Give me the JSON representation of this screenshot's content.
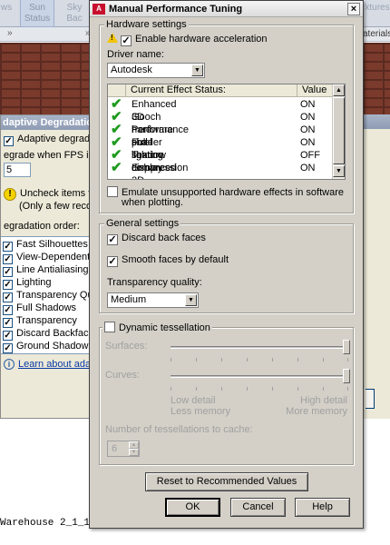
{
  "background": {
    "ribbon": {
      "left_label": "ws",
      "sun_status": "Sun\nStatus",
      "sky_label": "Sky Bac",
      "right_label": "xtures",
      "materials_label": "aterials",
      "collapse_glyph": "»"
    },
    "adaptive_dialog": {
      "title": "daptive Degradation",
      "adaptive_checkbox": "Adaptive degradation",
      "fps_label": "egrade when FPS is belo",
      "fps_value": "5",
      "warning_line1": "Uncheck items that",
      "warning_line2": "(Only a few recomm",
      "order_label": "egradation order:",
      "order_items": [
        "Fast Silhouettes",
        "View-Dependent Ob",
        "Line Antialiasing",
        "Lighting",
        "Transparency Qualit",
        "Full Shadows",
        "Transparency",
        "Discard Backfaces",
        "Ground Shadows"
      ],
      "learn_link": "Learn about adaptive"
    },
    "command_text": "Warehouse 2_1_1"
  },
  "dialog": {
    "title": "Manual Performance Tuning",
    "app_icon_text": "A",
    "close_glyph": "×",
    "hardware": {
      "legend": "Hardware settings",
      "enable_accel": "Enable hardware acceleration",
      "enable_accel_checked": true,
      "driver_label": "Driver name:",
      "driver_value": "Autodesk",
      "status_headers": [
        "Current Effect Status:",
        "Value"
      ],
      "effects": [
        {
          "name": "Enhanced 3D Performance",
          "value": "ON"
        },
        {
          "name": "Gooch hardware shader",
          "value": "ON"
        },
        {
          "name": "Per-pixel lighting",
          "value": "ON"
        },
        {
          "name": "Full-shadow display",
          "value": "ON"
        },
        {
          "name": "Texture compression",
          "value": "OFF"
        },
        {
          "name": "Enhanced 2D Performance",
          "value": "ON"
        }
      ],
      "emulate_line1": "Emulate unsupported hardware effects in software",
      "emulate_line2": "when plotting.",
      "emulate_checked": false
    },
    "general": {
      "legend": "General settings",
      "discard_back_faces": "Discard back faces",
      "discard_checked": true,
      "smooth_faces": "Smooth faces by default",
      "smooth_checked": true,
      "transparency_label": "Transparency quality:",
      "transparency_value": "Medium"
    },
    "tessellation": {
      "legend": "Dynamic tessellation",
      "checked": false,
      "surfaces_label": "Surfaces:",
      "curves_label": "Curves:",
      "low_detail": "Low detail",
      "less_memory": "Less memory",
      "high_detail": "High detail",
      "more_memory": "More memory",
      "cache_label": "Number of tessellations to cache:",
      "cache_value": "6",
      "surfaces_level": 1.0,
      "curves_level": 1.0
    },
    "buttons": {
      "reset": "Reset to Recommended Values",
      "ok": "OK",
      "cancel": "Cancel",
      "help": "Help"
    },
    "glyphs": {
      "check": "✔",
      "box_check": "✓",
      "arrow_down": "▼",
      "arrow_up": "▲"
    }
  }
}
